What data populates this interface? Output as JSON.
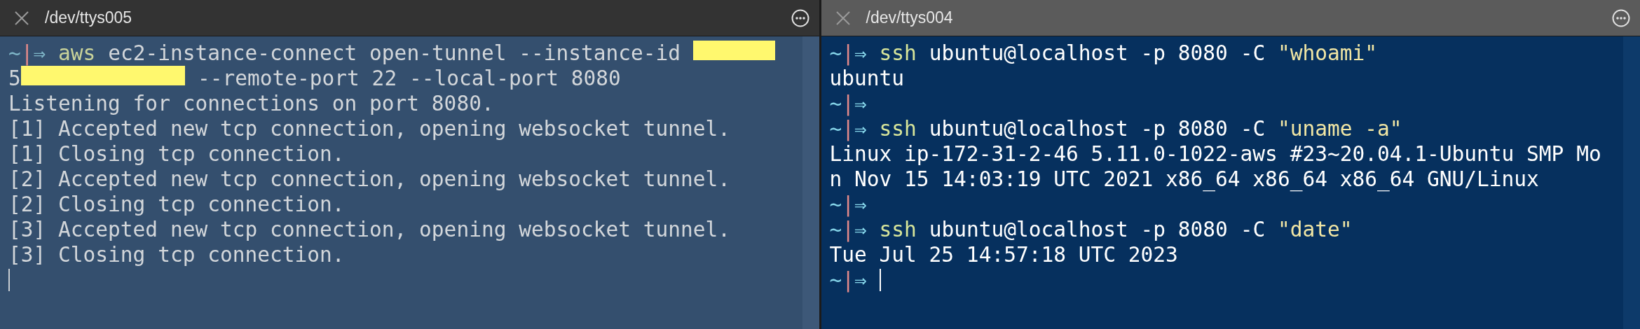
{
  "panes": [
    {
      "title": "/dev/ttys005",
      "active": false,
      "lines": [
        {
          "segments": [
            {
              "kind": "home",
              "text": "~"
            },
            {
              "kind": "sep",
              "text": "|"
            },
            {
              "kind": "arrow",
              "text": "⇒"
            },
            {
              "kind": "command",
              "text": "aws"
            },
            {
              "kind": "text",
              "text": "ec2-instance-connect open-tunnel --instance-id"
            },
            {
              "kind": "redacted"
            }
          ]
        },
        {
          "segments": [
            {
              "kind": "text",
              "text": "5"
            },
            {
              "kind": "redacted"
            },
            {
              "kind": "text",
              "text": "--remote-port 22 --local-port 8080"
            }
          ]
        },
        {
          "segments": [
            {
              "kind": "text",
              "text": "Listening for connections on port 8080."
            }
          ]
        },
        {
          "segments": [
            {
              "kind": "text",
              "text": "[1] Accepted new tcp connection, opening websocket tunnel."
            }
          ]
        },
        {
          "segments": [
            {
              "kind": "text",
              "text": "[1] Closing tcp connection."
            }
          ]
        },
        {
          "segments": [
            {
              "kind": "text",
              "text": "[2] Accepted new tcp connection, opening websocket tunnel."
            }
          ]
        },
        {
          "segments": [
            {
              "kind": "text",
              "text": "[2] Closing tcp connection."
            }
          ]
        },
        {
          "segments": [
            {
              "kind": "text",
              "text": "[3] Accepted new tcp connection, opening websocket tunnel."
            }
          ]
        },
        {
          "segments": [
            {
              "kind": "text",
              "text": "[3] Closing tcp connection."
            }
          ]
        },
        {
          "cursor": true
        }
      ]
    },
    {
      "title": "/dev/ttys004",
      "active": true,
      "lines": [
        {
          "segments": [
            {
              "kind": "home",
              "text": "~"
            },
            {
              "kind": "sep",
              "text": "|"
            },
            {
              "kind": "arrow",
              "text": "⇒"
            },
            {
              "kind": "command",
              "text": "ssh"
            },
            {
              "kind": "text",
              "text": "ubuntu@localhost -p 8080 -C"
            },
            {
              "kind": "quoted",
              "text": "\"whoami\""
            }
          ]
        },
        {
          "segments": [
            {
              "kind": "text",
              "text": "ubuntu"
            }
          ]
        },
        {
          "segments": [
            {
              "kind": "home",
              "text": "~"
            },
            {
              "kind": "sep",
              "text": "|"
            },
            {
              "kind": "arrow",
              "text": "⇒"
            }
          ]
        },
        {
          "segments": [
            {
              "kind": "home",
              "text": "~"
            },
            {
              "kind": "sep",
              "text": "|"
            },
            {
              "kind": "arrow",
              "text": "⇒"
            },
            {
              "kind": "command",
              "text": "ssh"
            },
            {
              "kind": "text",
              "text": "ubuntu@localhost -p 8080 -C"
            },
            {
              "kind": "quoted",
              "text": "\"uname -a\""
            }
          ]
        },
        {
          "segments": [
            {
              "kind": "text",
              "text": "Linux ip-172-31-2-46 5.11.0-1022-aws #23~20.04.1-Ubuntu SMP Mo"
            }
          ]
        },
        {
          "segments": [
            {
              "kind": "text",
              "text": "n Nov 15 14:03:19 UTC 2021 x86_64 x86_64 x86_64 GNU/Linux"
            }
          ]
        },
        {
          "segments": [
            {
              "kind": "home",
              "text": "~"
            },
            {
              "kind": "sep",
              "text": "|"
            },
            {
              "kind": "arrow",
              "text": "⇒"
            }
          ]
        },
        {
          "segments": [
            {
              "kind": "home",
              "text": "~"
            },
            {
              "kind": "sep",
              "text": "|"
            },
            {
              "kind": "arrow",
              "text": "⇒"
            },
            {
              "kind": "command",
              "text": "ssh"
            },
            {
              "kind": "text",
              "text": "ubuntu@localhost -p 8080 -C"
            },
            {
              "kind": "quoted",
              "text": "\"date\""
            }
          ]
        },
        {
          "segments": [
            {
              "kind": "text",
              "text": "Tue Jul 25 14:57:18 UTC 2023"
            }
          ]
        },
        {
          "segments": [
            {
              "kind": "home",
              "text": "~"
            },
            {
              "kind": "sep",
              "text": "|"
            },
            {
              "kind": "arrow",
              "text": "⇒"
            }
          ],
          "cursor": true
        }
      ]
    }
  ]
}
